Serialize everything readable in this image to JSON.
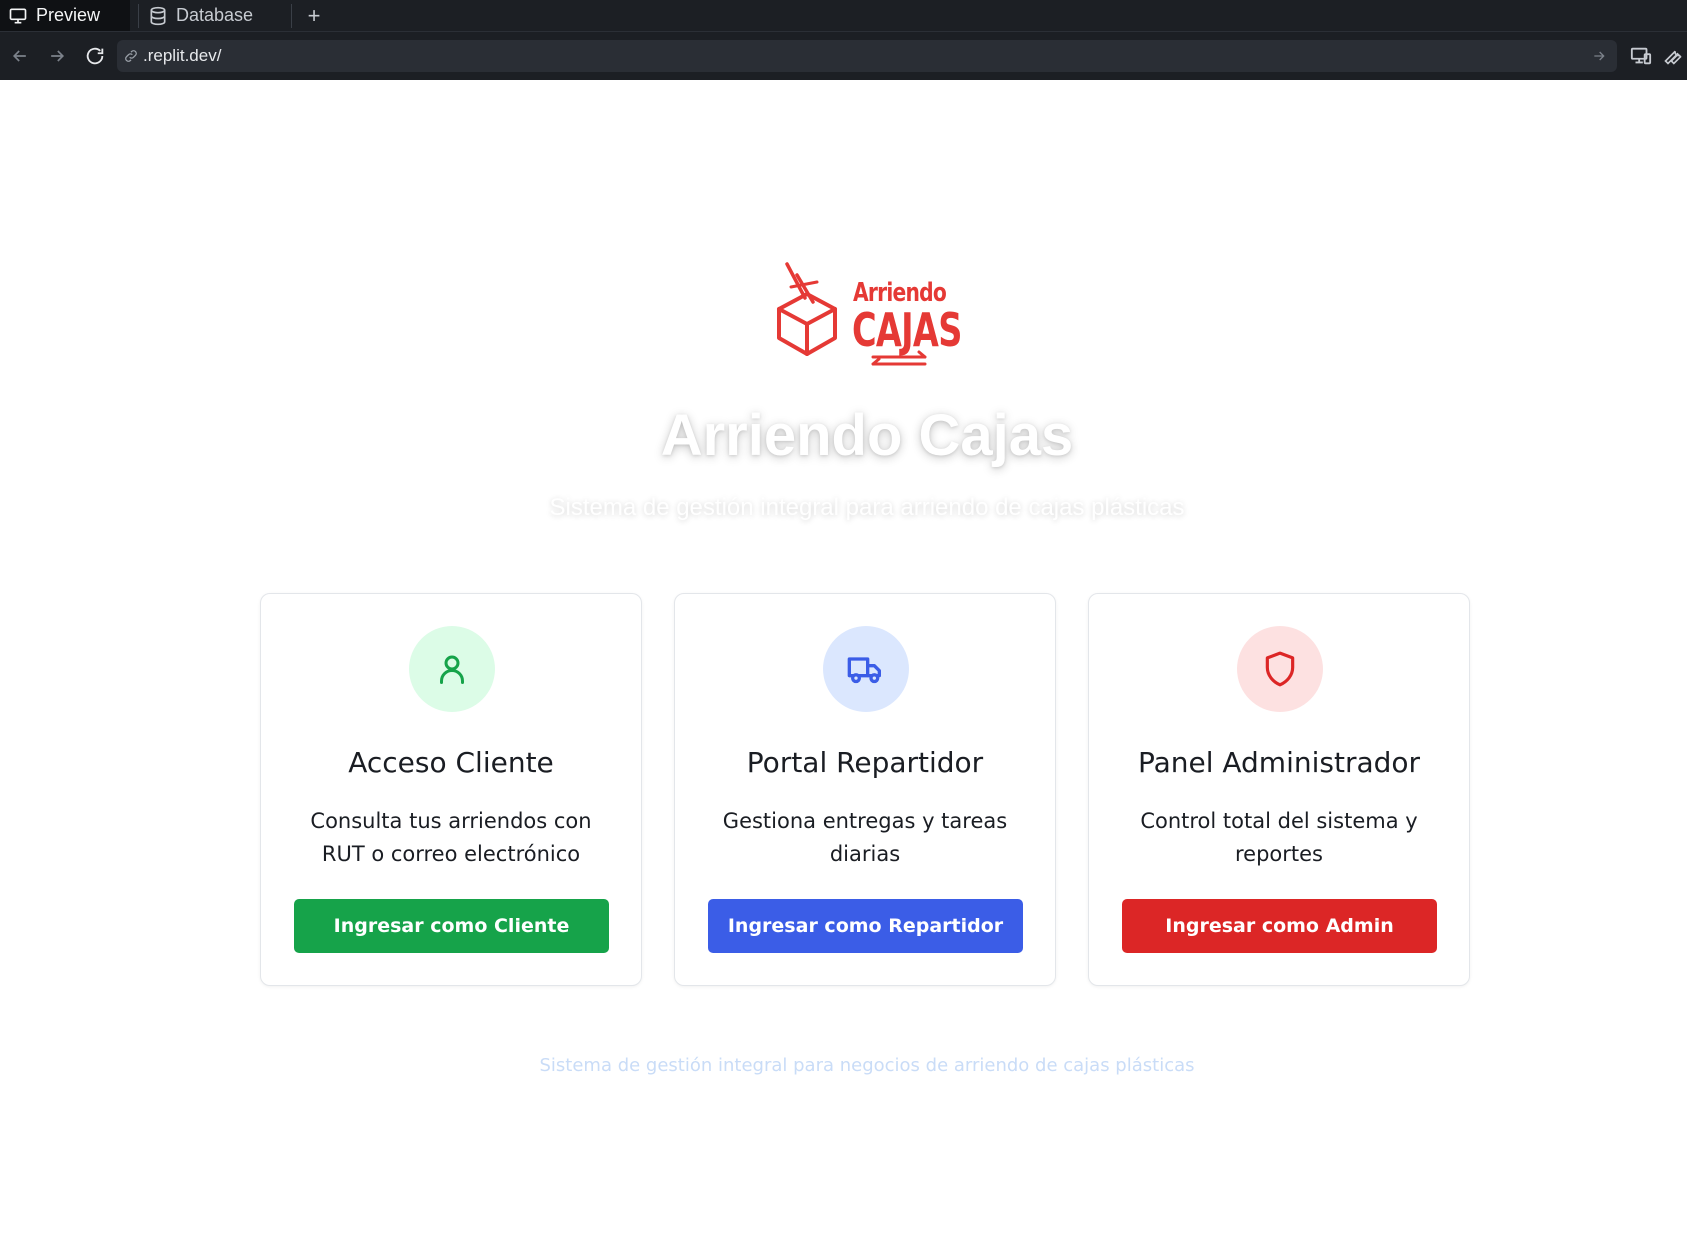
{
  "browser": {
    "tabs": [
      {
        "label": "Preview",
        "icon": "monitor-icon",
        "active": true
      },
      {
        "label": "Database",
        "icon": "database-icon",
        "active": false
      }
    ],
    "add_tab": "+",
    "url": ".replit.dev/"
  },
  "logo": {
    "line1": "Arriendo",
    "line2": "CAJAS",
    "color": "#e53935"
  },
  "hero": {
    "title": "Arriendo Cajas",
    "subtitle": "Sistema de gestión integral para arriendo de cajas plásticas"
  },
  "cards": [
    {
      "title": "Acceso Cliente",
      "description": "Consulta tus arriendos con RUT o correo electrónico",
      "button": "Ingresar como Cliente",
      "icon": "user-icon",
      "color": "#16a34a"
    },
    {
      "title": "Portal Repartidor",
      "description": "Gestiona entregas y tareas diarias",
      "button": "Ingresar como Repartidor",
      "icon": "truck-icon",
      "color": "#3b5de7"
    },
    {
      "title": "Panel Administrador",
      "description": "Control total del sistema y reportes",
      "button": "Ingresar como Admin",
      "icon": "shield-icon",
      "color": "#dc2626"
    }
  ],
  "footer": {
    "text": "Sistema de gestión integral para negocios de arriendo de cajas plásticas"
  }
}
